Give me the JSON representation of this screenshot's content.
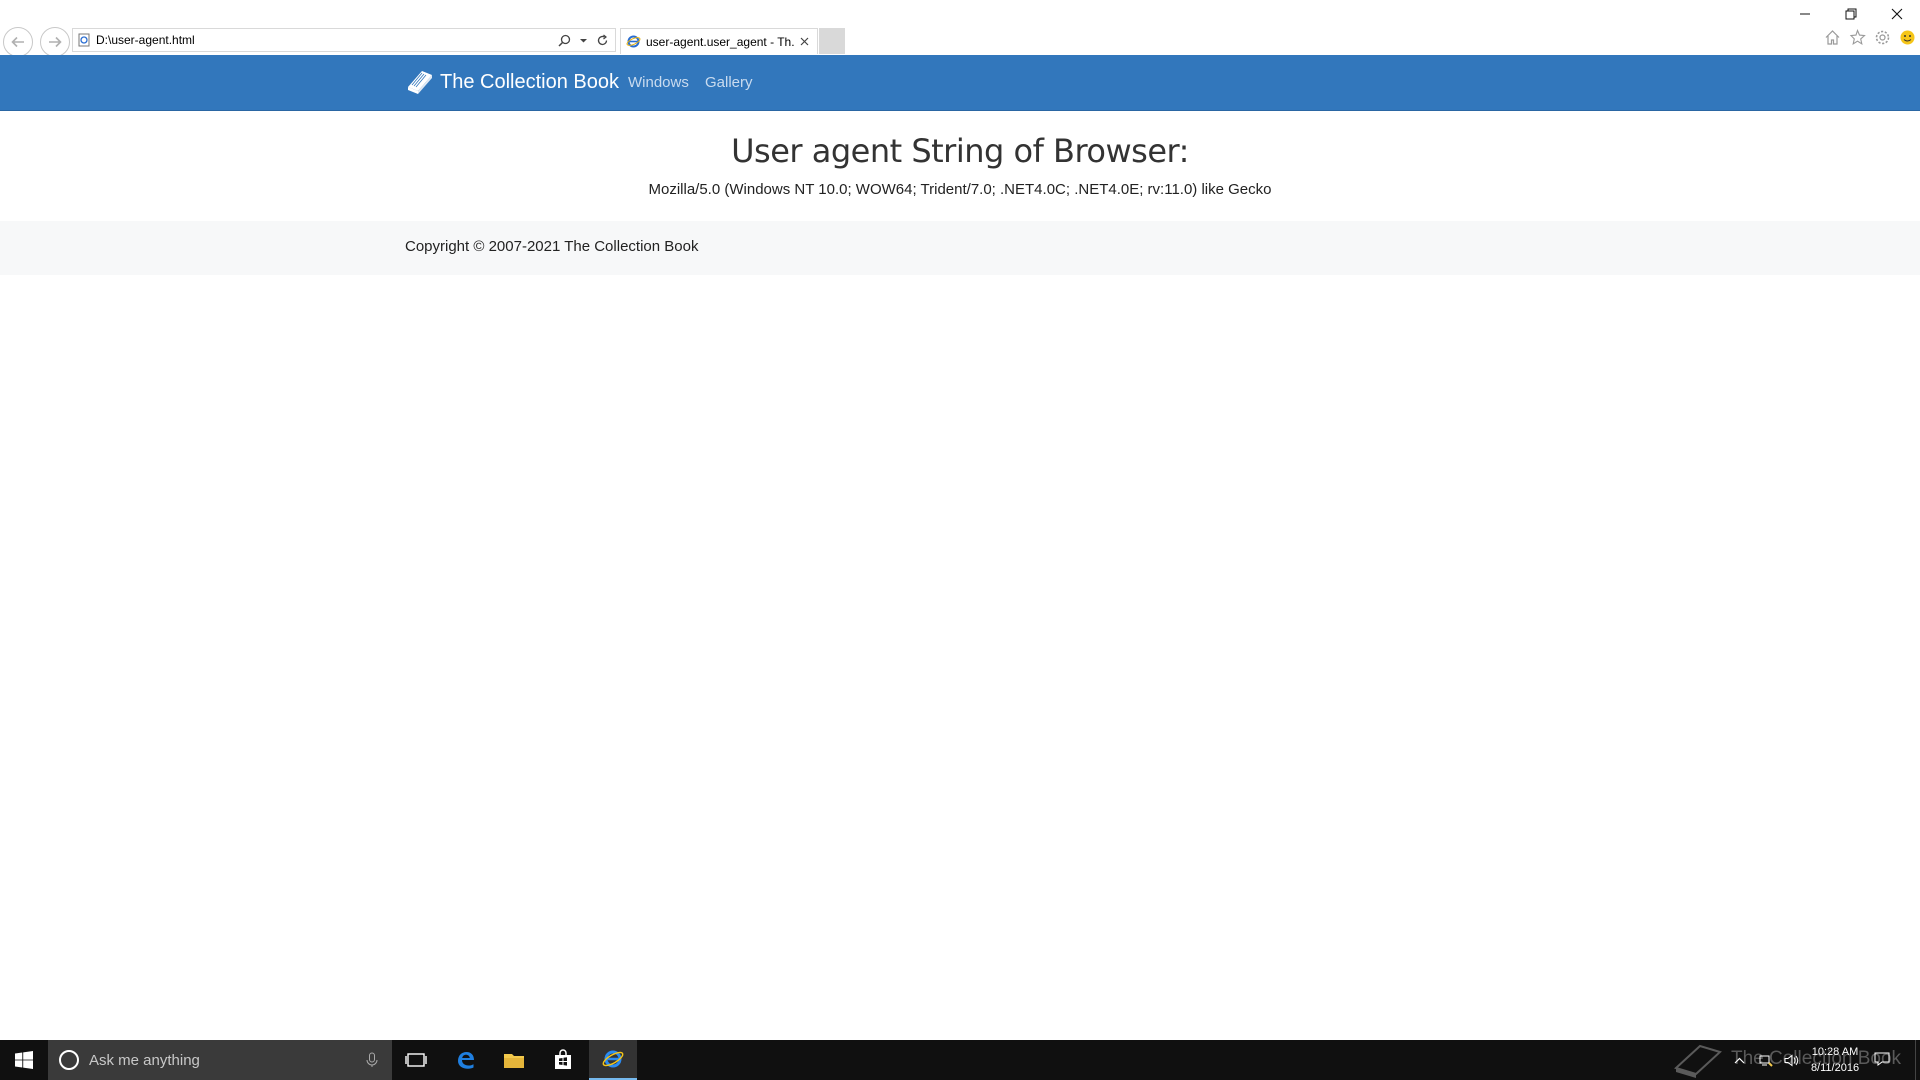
{
  "browser": {
    "address": "D:\\user-agent.html",
    "tab_title": "user-agent.user_agent - Th..."
  },
  "navbar": {
    "brand": "The Collection Book",
    "links": [
      "Windows",
      "Gallery"
    ],
    "background": "#3277bc"
  },
  "main": {
    "title": "User agent String of Browser:",
    "user_agent": "Mozilla/5.0 (Windows NT 10.0; WOW64; Trident/7.0; .NET4.0C; .NET4.0E; rv:11.0) like Gecko"
  },
  "footer": {
    "copyright": "Copyright © 2007-2021 The Collection Book"
  },
  "taskbar": {
    "search_placeholder": "Ask me anything",
    "watermark": "The Collection Book",
    "time": "10:28 AM",
    "date": "8/11/2016"
  }
}
